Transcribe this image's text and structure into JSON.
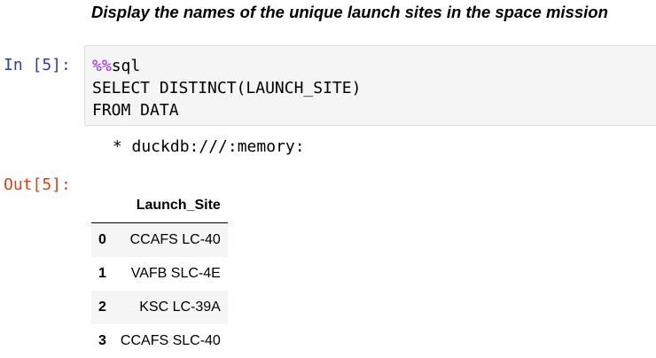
{
  "markdown": {
    "heading": "Display the names of the unique launch sites in the space mission"
  },
  "input_cell": {
    "prompt": "In [5]:",
    "code": {
      "magic": "%%",
      "line1_rest": "sql",
      "line2": "SELECT DISTINCT(LAUNCH_SITE)",
      "line3": "FROM DATA"
    }
  },
  "stream_output": " * duckdb:///:memory:",
  "output_cell": {
    "prompt": "Out[5]:"
  },
  "table": {
    "index_header": "",
    "columns": [
      "Launch_Site"
    ],
    "rows": [
      {
        "index": "0",
        "Launch_Site": "CCAFS LC-40"
      },
      {
        "index": "1",
        "Launch_Site": "VAFB SLC-4E"
      },
      {
        "index": "2",
        "Launch_Site": "KSC LC-39A"
      },
      {
        "index": "3",
        "Launch_Site": "CCAFS SLC-40"
      }
    ]
  }
}
